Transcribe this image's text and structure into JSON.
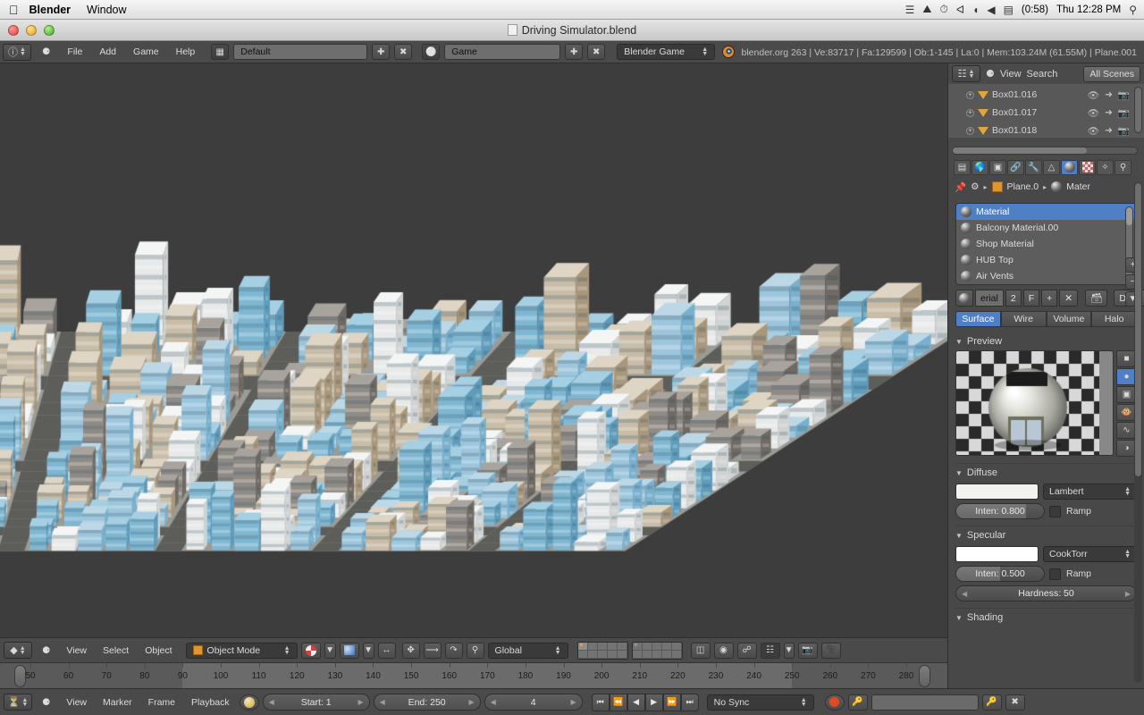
{
  "os_menubar": {
    "apple_icon": "apple-icon",
    "app_name": "Blender",
    "window_menu": "Window",
    "status_icons": [
      "display-icon",
      "home-icon",
      "time-machine-icon",
      "bluetooth-icon",
      "wifi-icon",
      "volume-icon",
      "battery-icon"
    ],
    "battery_time": "(0:58)",
    "clock": "Thu 12:28 PM",
    "search_icon": "spotlight-search-icon"
  },
  "window": {
    "title": "Driving Simulator.blend",
    "doc_icon": "document-icon",
    "close_label": "close-button",
    "minimize_label": "minimize-button",
    "zoom_label": "zoom-button"
  },
  "topbar": {
    "editor_icon": "info-editor-icon",
    "collapse_icon": "collapse-menu-icon",
    "menus": [
      "File",
      "Add",
      "Game",
      "Help"
    ],
    "screen_icon": "screen-layout-icon",
    "screen_layout": "Default",
    "scene_icon": "scene-icon",
    "scene_name": "Game",
    "add_icon": "add-icon",
    "delete_icon": "delete-icon",
    "engine": "Blender Game",
    "blender_logo": "blender-logo-icon",
    "status": "blender.org 263 | Ve:83717 | Fa:129599 | Ob:1-145 | La:0 | Mem:103.24M (61.55M) | Plane.001"
  },
  "outliner": {
    "editor_icon": "outliner-editor-icon",
    "collapse_icon": "collapse-menu-icon",
    "menus": [
      "View",
      "Search"
    ],
    "display_mode": "All Scenes",
    "rows": [
      {
        "name": "Box01.016",
        "expand_icon": "expand-icon",
        "type_icon": "mesh-icon",
        "eye_icon": "eye-icon",
        "cursor_icon": "select-arrow-icon",
        "camera_icon": "render-camera-icon"
      },
      {
        "name": "Box01.017",
        "expand_icon": "expand-icon",
        "type_icon": "mesh-icon",
        "eye_icon": "eye-icon",
        "cursor_icon": "select-arrow-icon",
        "camera_icon": "render-camera-icon"
      },
      {
        "name": "Box01.018",
        "expand_icon": "expand-icon",
        "type_icon": "mesh-icon",
        "eye_icon": "eye-icon",
        "cursor_icon": "select-arrow-icon",
        "camera_icon": "render-camera-icon"
      }
    ]
  },
  "properties": {
    "tabs": [
      {
        "name": "render-tab",
        "icon": "camera-back-icon",
        "active": false
      },
      {
        "name": "scene-tab",
        "icon": "globe-icon",
        "active": false
      },
      {
        "name": "object-tab",
        "icon": "cube-icon",
        "active": false
      },
      {
        "name": "constraints-tab",
        "icon": "chain-link-icon",
        "active": false
      },
      {
        "name": "modifiers-tab",
        "icon": "wrench-icon",
        "active": false
      },
      {
        "name": "data-tab",
        "icon": "mesh-data-icon",
        "active": false
      },
      {
        "name": "material-tab",
        "icon": "material-sphere-icon",
        "active": true
      },
      {
        "name": "texture-tab",
        "icon": "checker-icon",
        "active": false
      },
      {
        "name": "particles-tab",
        "icon": "particles-icon",
        "active": false
      },
      {
        "name": "physics-tab",
        "icon": "physics-icon",
        "active": false
      }
    ],
    "breadcrumb": {
      "pin_icon": "pin-icon",
      "scene_icon": "scene-icon",
      "object_icon": "object-cube-icon",
      "object_name": "Plane.0",
      "material_icon": "material-sphere-icon",
      "material_name": "Mater"
    },
    "material_slots": [
      {
        "label": "Material",
        "selected": true
      },
      {
        "label": "Balcony Material.00",
        "selected": false
      },
      {
        "label": "Shop Material",
        "selected": false
      },
      {
        "label": "HUB Top",
        "selected": false
      },
      {
        "label": "Air Vents",
        "selected": false
      }
    ],
    "slot_buttons": [
      {
        "name": "add-slot-button",
        "glyph": "+"
      },
      {
        "name": "remove-slot-button",
        "glyph": "−"
      },
      {
        "name": "slot-specials-button",
        "glyph": "▼"
      }
    ],
    "material_name_field": "erial",
    "users_count": "2",
    "fake_user": "F",
    "new_material_button": "+",
    "unlink_material_button": "✕",
    "browse_icon": "browse-material-icon",
    "datablock_letter": "D",
    "shading_tabs": [
      {
        "label": "Surface",
        "active": true
      },
      {
        "label": "Wire",
        "active": false
      },
      {
        "label": "Volume",
        "active": false
      },
      {
        "label": "Halo",
        "active": false
      }
    ],
    "preview": {
      "title": "Preview",
      "buttons": [
        {
          "name": "preview-flat-button",
          "icon": "flat-plane-icon",
          "active": false
        },
        {
          "name": "preview-sphere-button",
          "icon": "sphere-icon",
          "active": true
        },
        {
          "name": "preview-cube-button",
          "icon": "cube-icon",
          "active": false
        },
        {
          "name": "preview-monkey-button",
          "icon": "monkey-icon",
          "active": false
        },
        {
          "name": "preview-hair-button",
          "icon": "hair-strands-icon",
          "active": false
        },
        {
          "name": "preview-sphere-sky-button",
          "icon": "sphere-sky-icon",
          "active": false
        }
      ]
    },
    "diffuse": {
      "title": "Diffuse",
      "color": "#f2f2ee",
      "shader": "Lambert",
      "intensity": "Inten: 0.800",
      "intensity_fill_pct": 80,
      "ramp_label": "Ramp"
    },
    "specular": {
      "title": "Specular",
      "color": "#ffffff",
      "shader": "CookTorr",
      "intensity": "Inten: 0.500",
      "intensity_fill_pct": 50,
      "ramp_label": "Ramp",
      "hardness": "Hardness: 50"
    },
    "shading": {
      "title": "Shading"
    }
  },
  "viewport": {
    "editor_icon": "3d-view-editor-icon",
    "collapse_icon": "collapse-menu-icon",
    "menus": [
      "View",
      "Select",
      "Object"
    ],
    "mode_icon": "object-cube-icon",
    "mode": "Object Mode",
    "shading_icon": "viewport-shading-icon",
    "pivot_icon": "pivot-point-icon",
    "snap_magnet_icon": "magnet-icon",
    "manipulator_icons": [
      "translate-manipulator-icon",
      "rotate-manipulator-icon",
      "scale-manipulator-icon"
    ],
    "orientation": "Global",
    "extra_icons": [
      "lock-object-icon",
      "proportional-edit-icon",
      "snap-icon",
      "pivot-median-icon",
      "render-camera-add-icon",
      "render-animation-icon"
    ],
    "layers_block1_active_index": 0,
    "scene_background": "#3d3d3d",
    "model_description": "textured low-poly city block model"
  },
  "timeline": {
    "editor_icon": "timeline-editor-icon",
    "collapse_icon": "collapse-menu-icon",
    "menus": [
      "View",
      "Marker",
      "Frame",
      "Playback"
    ],
    "keying_icon": "keying-set-icon",
    "start": "Start: 1",
    "end": "End: 250",
    "current_frame": "4",
    "transport_buttons": [
      "jump-to-start-icon",
      "previous-keyframe-icon",
      "play-reverse-icon",
      "play-icon",
      "next-keyframe-icon",
      "jump-to-end-icon"
    ],
    "sync_mode": "No Sync",
    "record_icon": "record-button-icon",
    "auto_key_icon": "auto-keyframe-icon",
    "keying_set_field": "",
    "ruler_ticks": [
      50,
      60,
      70,
      80,
      90,
      100,
      110,
      120,
      130,
      140,
      150,
      160,
      170,
      180,
      190,
      200,
      210,
      220,
      230,
      240,
      250,
      260,
      270,
      280
    ],
    "range_start_tick": 90,
    "range_end_tick": 250
  },
  "colors": {
    "accent_blue": "#4f7fc4",
    "panel_bg": "#484848",
    "header_bg": "#4a4a4a",
    "viewport_bg": "#3d3d3d",
    "text": "#dcdcdc",
    "mesh_orange": "#e0a63c"
  }
}
